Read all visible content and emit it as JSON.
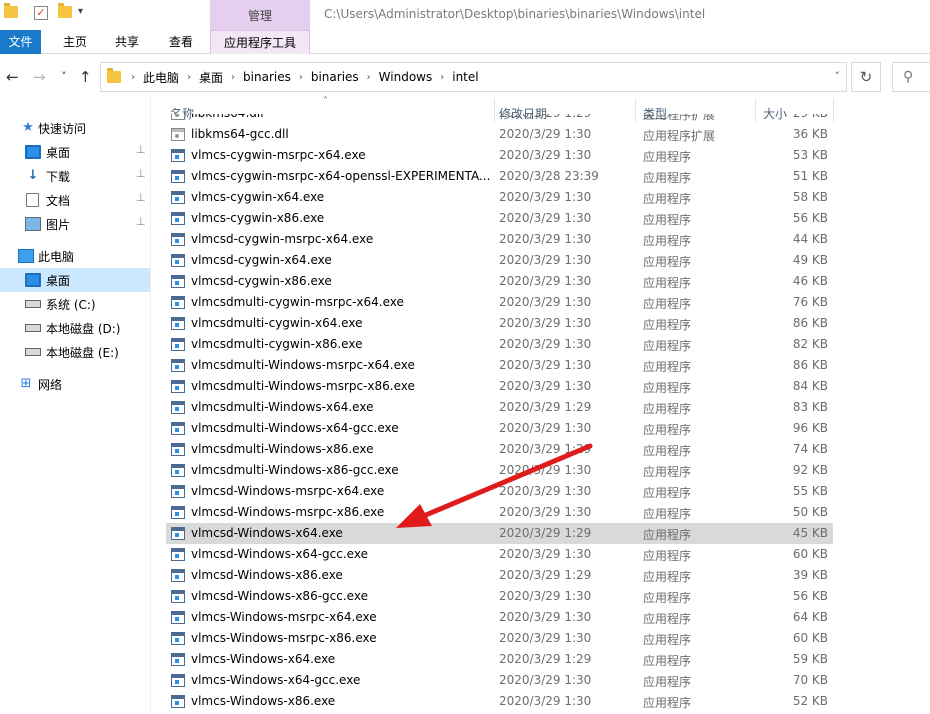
{
  "titlebar": {
    "context_tab": "管理",
    "path": "C:\\Users\\Administrator\\Desktop\\binaries\\binaries\\Windows\\intel",
    "qa_dropdown": "▾"
  },
  "ribbon": {
    "tabs": [
      {
        "label": "文件"
      },
      {
        "label": "主页"
      },
      {
        "label": "共享"
      },
      {
        "label": "查看"
      },
      {
        "label": "应用程序工具"
      }
    ]
  },
  "address": {
    "segments": [
      "此电脑",
      "桌面",
      "binaries",
      "binaries",
      "Windows",
      "intel"
    ],
    "back": "←",
    "forward": "→",
    "recent": "˅",
    "up": "↑",
    "refresh": "↻",
    "search_icon": "⚲",
    "chevron": "˅"
  },
  "nav": {
    "quick_access": "快速访问",
    "items": [
      {
        "label": "桌面",
        "pinned": true,
        "icon": "desktop-icon"
      },
      {
        "label": "下载",
        "pinned": true,
        "icon": "download-icon"
      },
      {
        "label": "文档",
        "pinned": true,
        "icon": "documents-icon"
      },
      {
        "label": "图片",
        "pinned": true,
        "icon": "pictures-icon"
      }
    ],
    "this_pc": "此电脑",
    "pc_items": [
      {
        "label": "桌面",
        "selected": true
      },
      {
        "label": "系统 (C:)"
      },
      {
        "label": "本地磁盘 (D:)"
      },
      {
        "label": "本地磁盘 (E:)"
      }
    ],
    "network": "网络",
    "pin_glyph": "📌"
  },
  "columns": {
    "name": "名称",
    "date": "修改日期",
    "type": "类型",
    "size": "大小",
    "sort_glyph": "˄"
  },
  "files": [
    {
      "name": "libkms64.dll",
      "date": "2020/3/29 1:29",
      "type": "应用程序扩展",
      "size": "29 KB",
      "kind": "dll"
    },
    {
      "name": "libkms64-gcc.dll",
      "date": "2020/3/29 1:30",
      "type": "应用程序扩展",
      "size": "36 KB",
      "kind": "dll"
    },
    {
      "name": "vlmcs-cygwin-msrpc-x64.exe",
      "date": "2020/3/29 1:30",
      "type": "应用程序",
      "size": "53 KB",
      "kind": "exe"
    },
    {
      "name": "vlmcs-cygwin-msrpc-x64-openssl-EXPERIMENTA...",
      "date": "2020/3/28 23:39",
      "type": "应用程序",
      "size": "51 KB",
      "kind": "exe"
    },
    {
      "name": "vlmcs-cygwin-x64.exe",
      "date": "2020/3/29 1:30",
      "type": "应用程序",
      "size": "58 KB",
      "kind": "exe"
    },
    {
      "name": "vlmcs-cygwin-x86.exe",
      "date": "2020/3/29 1:30",
      "type": "应用程序",
      "size": "56 KB",
      "kind": "exe"
    },
    {
      "name": "vlmcsd-cygwin-msrpc-x64.exe",
      "date": "2020/3/29 1:30",
      "type": "应用程序",
      "size": "44 KB",
      "kind": "exe"
    },
    {
      "name": "vlmcsd-cygwin-x64.exe",
      "date": "2020/3/29 1:30",
      "type": "应用程序",
      "size": "49 KB",
      "kind": "exe"
    },
    {
      "name": "vlmcsd-cygwin-x86.exe",
      "date": "2020/3/29 1:30",
      "type": "应用程序",
      "size": "46 KB",
      "kind": "exe"
    },
    {
      "name": "vlmcsdmulti-cygwin-msrpc-x64.exe",
      "date": "2020/3/29 1:30",
      "type": "应用程序",
      "size": "76 KB",
      "kind": "exe"
    },
    {
      "name": "vlmcsdmulti-cygwin-x64.exe",
      "date": "2020/3/29 1:30",
      "type": "应用程序",
      "size": "86 KB",
      "kind": "exe"
    },
    {
      "name": "vlmcsdmulti-cygwin-x86.exe",
      "date": "2020/3/29 1:30",
      "type": "应用程序",
      "size": "82 KB",
      "kind": "exe"
    },
    {
      "name": "vlmcsdmulti-Windows-msrpc-x64.exe",
      "date": "2020/3/29 1:30",
      "type": "应用程序",
      "size": "86 KB",
      "kind": "exe"
    },
    {
      "name": "vlmcsdmulti-Windows-msrpc-x86.exe",
      "date": "2020/3/29 1:30",
      "type": "应用程序",
      "size": "84 KB",
      "kind": "exe"
    },
    {
      "name": "vlmcsdmulti-Windows-x64.exe",
      "date": "2020/3/29 1:29",
      "type": "应用程序",
      "size": "83 KB",
      "kind": "exe"
    },
    {
      "name": "vlmcsdmulti-Windows-x64-gcc.exe",
      "date": "2020/3/29 1:30",
      "type": "应用程序",
      "size": "96 KB",
      "kind": "exe"
    },
    {
      "name": "vlmcsdmulti-Windows-x86.exe",
      "date": "2020/3/29 1:29",
      "type": "应用程序",
      "size": "74 KB",
      "kind": "exe"
    },
    {
      "name": "vlmcsdmulti-Windows-x86-gcc.exe",
      "date": "2020/3/29 1:30",
      "type": "应用程序",
      "size": "92 KB",
      "kind": "exe"
    },
    {
      "name": "vlmcsd-Windows-msrpc-x64.exe",
      "date": "2020/3/29 1:30",
      "type": "应用程序",
      "size": "55 KB",
      "kind": "exe"
    },
    {
      "name": "vlmcsd-Windows-msrpc-x86.exe",
      "date": "2020/3/29 1:30",
      "type": "应用程序",
      "size": "50 KB",
      "kind": "exe"
    },
    {
      "name": "vlmcsd-Windows-x64.exe",
      "date": "2020/3/29 1:29",
      "type": "应用程序",
      "size": "45 KB",
      "kind": "exe",
      "selected": true
    },
    {
      "name": "vlmcsd-Windows-x64-gcc.exe",
      "date": "2020/3/29 1:30",
      "type": "应用程序",
      "size": "60 KB",
      "kind": "exe"
    },
    {
      "name": "vlmcsd-Windows-x86.exe",
      "date": "2020/3/29 1:29",
      "type": "应用程序",
      "size": "39 KB",
      "kind": "exe"
    },
    {
      "name": "vlmcsd-Windows-x86-gcc.exe",
      "date": "2020/3/29 1:30",
      "type": "应用程序",
      "size": "56 KB",
      "kind": "exe"
    },
    {
      "name": "vlmcs-Windows-msrpc-x64.exe",
      "date": "2020/3/29 1:30",
      "type": "应用程序",
      "size": "64 KB",
      "kind": "exe"
    },
    {
      "name": "vlmcs-Windows-msrpc-x86.exe",
      "date": "2020/3/29 1:30",
      "type": "应用程序",
      "size": "60 KB",
      "kind": "exe"
    },
    {
      "name": "vlmcs-Windows-x64.exe",
      "date": "2020/3/29 1:29",
      "type": "应用程序",
      "size": "59 KB",
      "kind": "exe"
    },
    {
      "name": "vlmcs-Windows-x64-gcc.exe",
      "date": "2020/3/29 1:30",
      "type": "应用程序",
      "size": "70 KB",
      "kind": "exe"
    },
    {
      "name": "vlmcs-Windows-x86.exe",
      "date": "2020/3/29 1:30",
      "type": "应用程序",
      "size": "52 KB",
      "kind": "exe"
    }
  ],
  "colors": {
    "file_tab": "#1979ca",
    "context_tab": "#e6cfee",
    "selection": "#d9d9d9",
    "nav_selection": "#cce8ff",
    "annotation_arrow": "#e01b1b"
  }
}
